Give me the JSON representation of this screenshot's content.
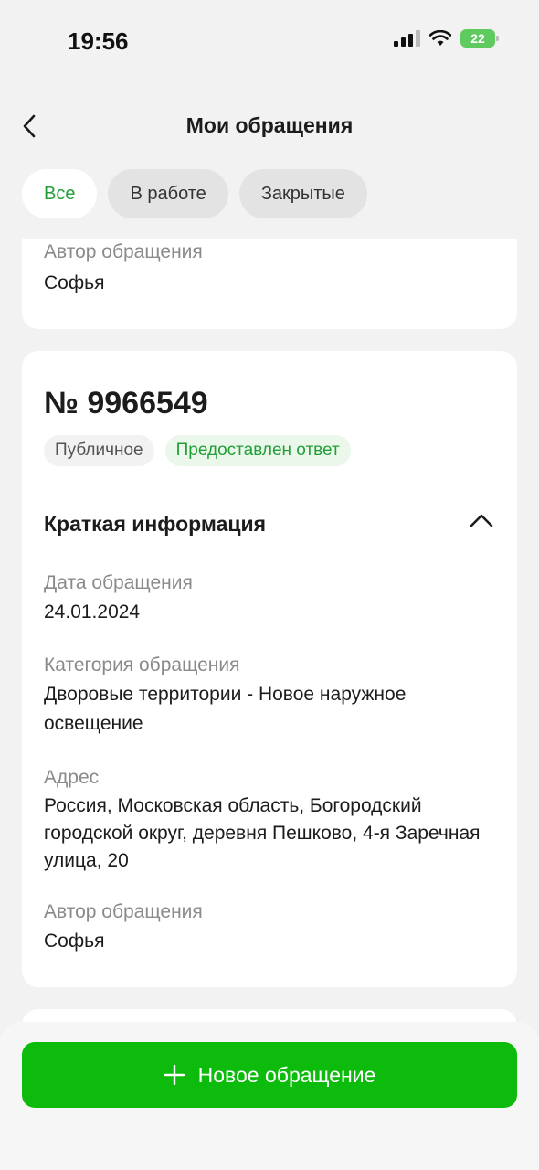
{
  "status_bar": {
    "time": "19:56",
    "battery": "22"
  },
  "header": {
    "title": "Мои обращения"
  },
  "tabs": [
    {
      "label": "Все",
      "active": true
    },
    {
      "label": "В работе",
      "active": false
    },
    {
      "label": "Закрытые",
      "active": false
    }
  ],
  "previous_card": {
    "author_label": "Автор обращения",
    "author_value": "Софья"
  },
  "issue": {
    "number": "№ 9966549",
    "badge_visibility": "Публичное",
    "badge_status": "Предоставлен ответ",
    "section_title": "Краткая информация",
    "date_label": "Дата обращения",
    "date_value": "24.01.2024",
    "category_label": "Категория обращения",
    "category_value": "Дворовые территории - Новое наружное освещение",
    "address_label": "Адрес",
    "address_value": "Россия, Московская область, Богородский городской округ, деревня Пешково, 4-я Заречная улица, 20",
    "author_label": "Автор обращения",
    "author_value": "Софья"
  },
  "footer": {
    "new_issue_label": "Новое обращение"
  },
  "colors": {
    "accent_green": "#0cbb0c",
    "status_green": "#21a038",
    "background": "#f2f2f2"
  }
}
